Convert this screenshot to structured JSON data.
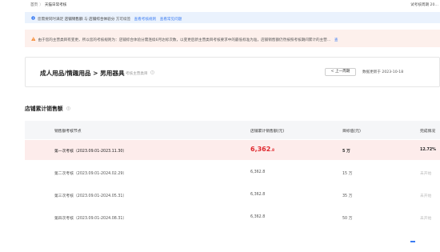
{
  "breadcrumb": {
    "home": "首页",
    "separator": "〉",
    "current": "天猫日常考核"
  },
  "header_right": "试考核周期 20…",
  "info_bar": {
    "icon": "info-circle-icon",
    "color": "#3b7cf2",
    "text_prefix": "您需要同时满足",
    "text_highlight_1": "店铺销售额",
    "text_mid": "与",
    "text_highlight_2": "店铺综合体验分",
    "text_suffix": "方可续签",
    "link_1": "查看考核规则",
    "link_2": "查看常见问题"
  },
  "warning_bar": {
    "icon": "warning-triangle-icon",
    "color": "#f5862b",
    "text_prefix": "由于您的主营类目有变更，所以您的考核规则为：",
    "text_body": "店铺综合体验分需连续6月达标次数，以变更后新主营类目考核要求中的最低标准为准，店铺销售额仍然按照考核期间累计的主营…",
    "link": "查"
  },
  "title_card": {
    "title": "成人用品/情趣用品 > 男用器具",
    "subtitle": "考核主营类目",
    "prev_button": "< 上一周期",
    "updated_text": "数据更新于 2023-10-18"
  },
  "section": {
    "title": "店铺累计销售额"
  },
  "table": {
    "columns": [
      "销售额考核节点",
      "店铺累计销售额(元)",
      "目标值(元)",
      "完成情况"
    ],
    "rows": [
      {
        "node": "第一次考核（2023.09.01-2023.11.30）",
        "sales_int": "6,362",
        "sales_frac": ".8",
        "target": "5 万",
        "status": "12.72%",
        "active": true
      },
      {
        "node": "第二次考核（2023.09.01-2024.02.29）",
        "sales": "6,362.8",
        "target": "15 万",
        "status": "未开始",
        "active": false
      },
      {
        "node": "第三次考核（2023.09.01-2024.05.31）",
        "sales": "6,362.8",
        "target": "35 万",
        "status": "未开始",
        "active": false
      },
      {
        "node": "第四次考核（2023.09.01-2024.08.31）",
        "sales": "6,362.8",
        "target": "50 万",
        "status": "未开始",
        "active": false
      }
    ]
  },
  "colors": {
    "accent": "#3b7cf2",
    "alert_red": "#e0282e",
    "active_row_bg": "#fdeceb"
  }
}
